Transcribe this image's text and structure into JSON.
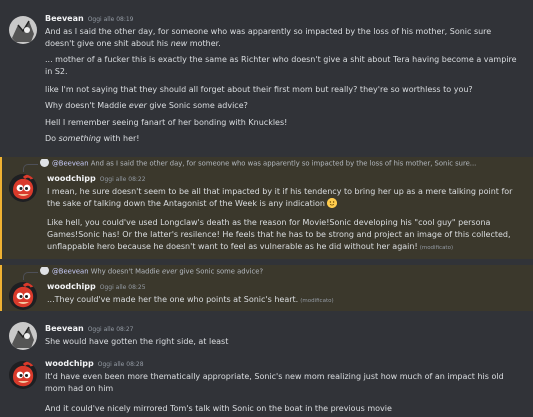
{
  "messages": [
    {
      "author": "Beevean",
      "timestamp": "Oggi alle 08:19",
      "lines": [
        {
          "a": "And as I said the other day, for someone who was apparently so impacted by the loss of his mother, Sonic sure doesn't give one shit about his ",
          "em": "new",
          "b": " mother."
        },
        {
          "a": "... mother of a fucker this is exactly the same as Richter who doesn't give a shit about Tera having become a vampire in S2."
        },
        {
          "a": "like I'm not saying that they should all forget about their first mom but really? they're so worthless to you?"
        },
        {
          "a": "Why doesn't Maddie ",
          "em": "ever",
          "b": " give Sonic some advice?"
        },
        {
          "a": "Hell I remember seeing fanart of her bonding with Knuckles!"
        },
        {
          "a": "Do ",
          "em": "something",
          "b": " with her!"
        }
      ]
    },
    {
      "reply": {
        "author": "@Beevean",
        "text": "And as I said the other day, for someone who was apparently so impacted by the loss of his mother, Sonic sure..."
      },
      "author": "woodchipp",
      "timestamp": "Oggi alle 08:22",
      "lines": [
        {
          "a": "I mean, he sure doesn't seem to be all that impacted by it if his tendency to bring her up as a mere talking point for the sake of talking down the Antagonist of the Week is any indication "
        },
        {
          "a": "Like hell, you could've used Longclaw's death as the reason for Movie!Sonic developing his \"cool guy\" persona Games!Sonic has! Or the latter's resilence! He feels that he has to be strong and project an image of this collected, unflappable hero because he doesn't want to feel as vulnerable as he did without her again!",
          "edited": "(modificato)"
        }
      ]
    },
    {
      "reply": {
        "author": "@Beevean",
        "pre": "Why doesn't Maddie ",
        "em": "ever",
        "post": " give Sonic some advice?"
      },
      "author": "woodchipp",
      "timestamp": "Oggi alle 08:25",
      "lines": [
        {
          "a": "...They could've made her the one who points at Sonic's heart.",
          "edited": "(modificato)"
        }
      ]
    },
    {
      "author": "Beevean",
      "timestamp": "Oggi alle 08:27",
      "lines": [
        {
          "a": "She would have gotten the right side, at least"
        }
      ]
    },
    {
      "author": "woodchipp",
      "timestamp": "Oggi alle 08:28",
      "lines": [
        {
          "a": "It'd have even been more thematically appropriate, Sonic's new mom realizing just how much of an impact his old mom had on him"
        },
        {
          "a": "And it could've nicely mirrored Tom's talk with Sonic on the boat in the previous movie"
        }
      ]
    }
  ],
  "colors": {
    "background": "#313338",
    "highlight": "#3b382c",
    "highlight_bar": "#f0b232",
    "text": "#dbdee1",
    "muted": "#949ba4"
  },
  "icons": {
    "emoji": "slightly-smiling-face",
    "reply": "reply-curve-icon"
  }
}
